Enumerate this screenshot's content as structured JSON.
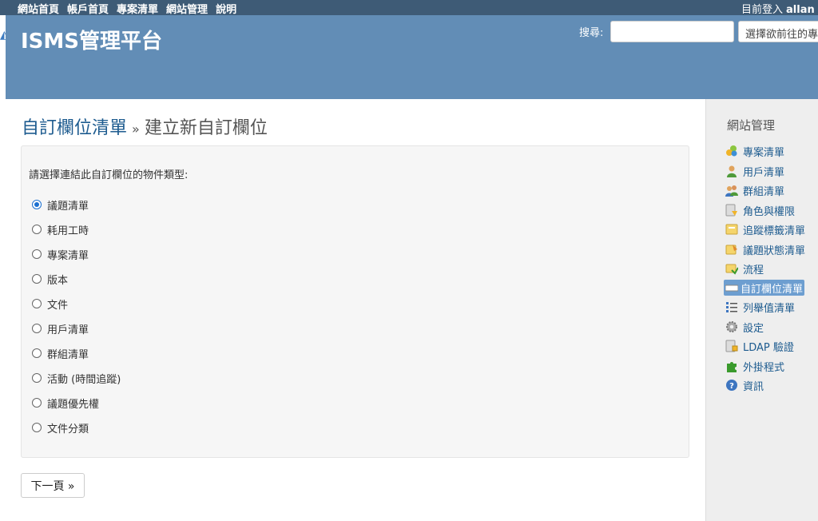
{
  "top_menu": {
    "links": [
      "網站首頁",
      "帳戶首頁",
      "專案清單",
      "網站管理",
      "說明"
    ],
    "logged_in_label": "目前登入",
    "user": "allan"
  },
  "header": {
    "app_title": "ISMS管理平台",
    "search_label": "搜尋:",
    "search_value": "",
    "project_jump": "選擇欲前往的專案..."
  },
  "main": {
    "breadcrumb": "自訂欄位清單",
    "breadcrumb_sep": "»",
    "title": "建立新自訂欄位",
    "prompt": "請選擇連結此自訂欄位的物件類型:",
    "options": [
      "議題清單",
      "耗用工時",
      "專案清單",
      "版本",
      "文件",
      "用戶清單",
      "群組清單",
      "活動 (時間追蹤)",
      "議題優先權",
      "文件分類"
    ],
    "selected_option": "議題清單",
    "next_button": "下一頁 »"
  },
  "sidebar": {
    "heading": "網站管理",
    "items": [
      {
        "label": "專案清單",
        "icon": "projects-icon"
      },
      {
        "label": "用戶清單",
        "icon": "user-icon"
      },
      {
        "label": "群組清單",
        "icon": "group-icon"
      },
      {
        "label": "角色與權限",
        "icon": "roles-icon"
      },
      {
        "label": "追蹤標籤清單",
        "icon": "trackers-icon"
      },
      {
        "label": "議題狀態清單",
        "icon": "issue-status-icon"
      },
      {
        "label": "流程",
        "icon": "workflow-icon"
      },
      {
        "label": "自訂欄位清單",
        "icon": "custom-fields-icon"
      },
      {
        "label": "列舉值清單",
        "icon": "enumerations-icon"
      },
      {
        "label": "設定",
        "icon": "settings-gear-icon"
      },
      {
        "label": "LDAP 驗證",
        "icon": "ldap-icon"
      },
      {
        "label": "外掛程式",
        "icon": "plugin-icon"
      },
      {
        "label": "資訊",
        "icon": "info-icon"
      }
    ],
    "selected": "自訂欄位清單"
  }
}
